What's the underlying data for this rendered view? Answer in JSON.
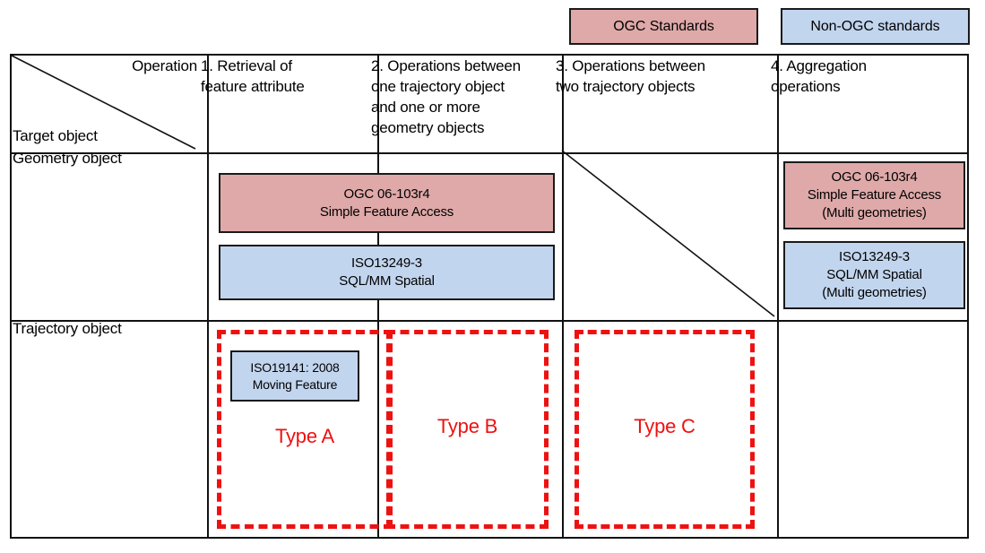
{
  "legend": {
    "ogc": {
      "label": "OGC Standards",
      "color": "#dfa9a9"
    },
    "non_ogc": {
      "label": "Non-OGC standards",
      "color": "#c2d5ee"
    }
  },
  "colors": {
    "ogc_fill": "#dfa9a9",
    "non_ogc_fill": "#c2d5ee",
    "border": "#1a1a1a",
    "type_box_red": "#ee1111",
    "grid": "#111111"
  },
  "table": {
    "corner": {
      "operation_label": "Operation",
      "target_label": "Target object"
    },
    "columns": [
      {
        "label": "1. Retrieval of\nfeature attribute"
      },
      {
        "label": "2. Operations between\none trajectory object\nand one or more\ngeometry objects"
      },
      {
        "label": "3. Operations between\ntwo trajectory objects"
      },
      {
        "label": "4. Aggregation\noperations"
      }
    ],
    "rows": [
      {
        "label": "Geometry object"
      },
      {
        "label": "Trajectory object"
      }
    ]
  },
  "boxes": {
    "sfa_wide": {
      "text": "OGC 06-103r4\nSimple Feature Access",
      "kind": "ogc"
    },
    "sqlmm_wide": {
      "text": "ISO13249-3\nSQL/MM  Spatial",
      "kind": "non_ogc"
    },
    "sfa_multi": {
      "text": "OGC 06-103r4\nSimple Feature Access\n(Multi geometries)",
      "kind": "ogc"
    },
    "sqlmm_multi": {
      "text": "ISO13249-3\nSQL/MM Spatial\n(Multi geometries)",
      "kind": "non_ogc"
    },
    "iso19141": {
      "text": "ISO19141: 2008\nMoving Feature",
      "kind": "non_ogc"
    }
  },
  "type_boxes": [
    {
      "label": "Type A"
    },
    {
      "label": "Type B"
    },
    {
      "label": "Type C"
    }
  ]
}
